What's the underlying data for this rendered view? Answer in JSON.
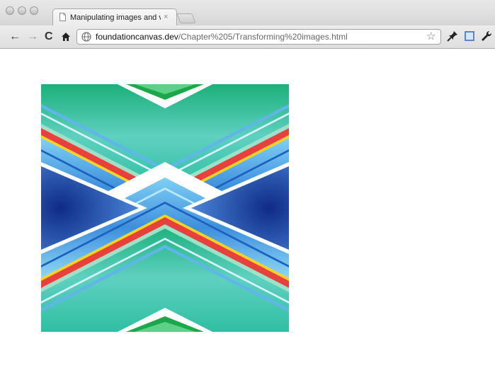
{
  "window": {
    "tab_title": "Manipulating images and vid",
    "tab_close": "×"
  },
  "toolbar": {
    "back": "←",
    "forward": "→",
    "reload": "C",
    "url_host": "foundationcanvas.dev",
    "url_path": "/Chapter%205/Transforming%20images.html",
    "bookmark_star": "☆"
  },
  "content": {
    "palette": {
      "green": "#1aa84a",
      "teal": "#2fbfa3",
      "sky": "#5fb6e8",
      "red": "#e8403a",
      "yellow": "#f5d31e",
      "navy": "#1c3f9e",
      "white": "#ffffff"
    }
  }
}
